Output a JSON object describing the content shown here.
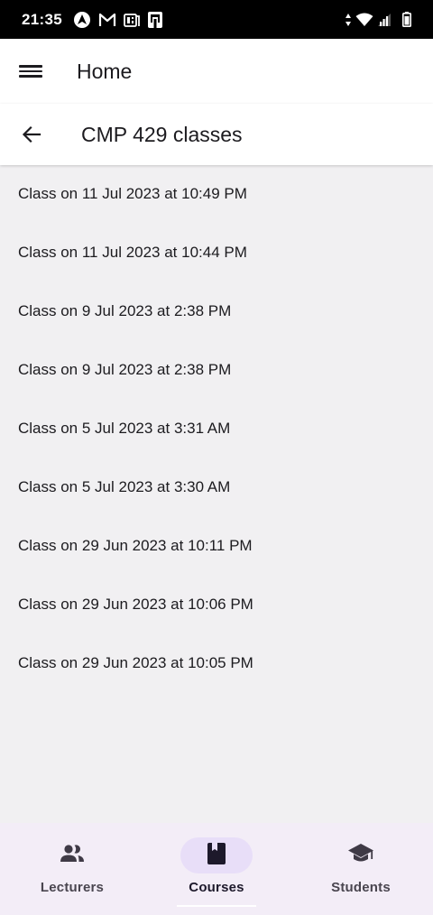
{
  "status_bar": {
    "time": "21:35",
    "left_icons": [
      "android-auto-icon",
      "gmail-icon",
      "news-icon",
      "tablet-icon"
    ],
    "right_icons": [
      "data-arrows-icon",
      "wifi-icon",
      "signal-icon",
      "battery-icon"
    ]
  },
  "app_bar": {
    "title": "Home",
    "menu_icon": "menu-icon"
  },
  "sub_bar": {
    "title": "CMP 429 classes",
    "back_icon": "arrow-back-icon"
  },
  "classes": [
    {
      "label": "Class on 11 Jul 2023 at 10:49 PM"
    },
    {
      "label": "Class on 11 Jul 2023 at 10:44 PM"
    },
    {
      "label": "Class on 9 Jul 2023 at 2:38 PM"
    },
    {
      "label": "Class on 9 Jul 2023 at 2:38 PM"
    },
    {
      "label": "Class on 5 Jul 2023 at 3:31 AM"
    },
    {
      "label": "Class on 5 Jul 2023 at 3:30 AM"
    },
    {
      "label": "Class on 29 Jun 2023 at 10:11 PM"
    },
    {
      "label": "Class on 29 Jun 2023 at 10:06 PM"
    },
    {
      "label": "Class on 29 Jun 2023 at 10:05 PM"
    }
  ],
  "bottom_nav": {
    "items": [
      {
        "label": "Lecturers",
        "icon": "people-icon",
        "active": false
      },
      {
        "label": "Courses",
        "icon": "book-icon",
        "active": true
      },
      {
        "label": "Students",
        "icon": "graduation-cap-icon",
        "active": false
      }
    ]
  },
  "colors": {
    "status_bar": "#000000",
    "app_bar": "#ffffff",
    "background": "#f1f0f2",
    "bottom_nav": "#f3edf7",
    "active_indicator": "#e8def8",
    "text_primary": "#1c1b1f",
    "icon": "#3f3a46"
  }
}
